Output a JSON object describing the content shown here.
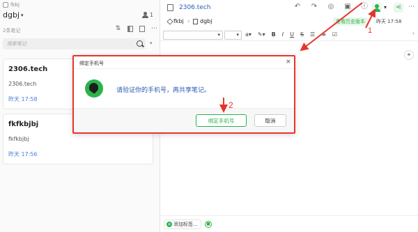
{
  "sidebar": {
    "notebook_small": "fkbj",
    "notebook_title": "dgbj",
    "shared_count": "1",
    "note_count": "2条笔记",
    "search_placeholder": "搜索笔记",
    "notes": [
      {
        "title": "2306.tech",
        "body": "2306.tech",
        "time": "昨天 17:58"
      },
      {
        "title": "fkfkbjbj",
        "body": "fkfkbjbj",
        "time": "昨天 17:56"
      }
    ]
  },
  "editor": {
    "doc_title": "2306.tech",
    "breadcrumb_notebook": "fkbj",
    "breadcrumb_sep": "›",
    "breadcrumb_stack": "dgbj",
    "history_label": "查看历史版本",
    "updated_time": "昨天 17:58",
    "add_tag_label": "添加标签..."
  },
  "dialog": {
    "title": "绑定手机号",
    "message": "请验证你的手机号，再共享笔记。",
    "bind_button": "绑定手机号",
    "cancel_button": "取消",
    "close_glyph": "×"
  },
  "annotations": {
    "step1": "1",
    "step2": "2",
    "color": "#e5352b"
  },
  "colors": {
    "accent_green": "#2bb24c",
    "link_blue": "#2a5db0",
    "annotation_red": "#e5352b"
  }
}
